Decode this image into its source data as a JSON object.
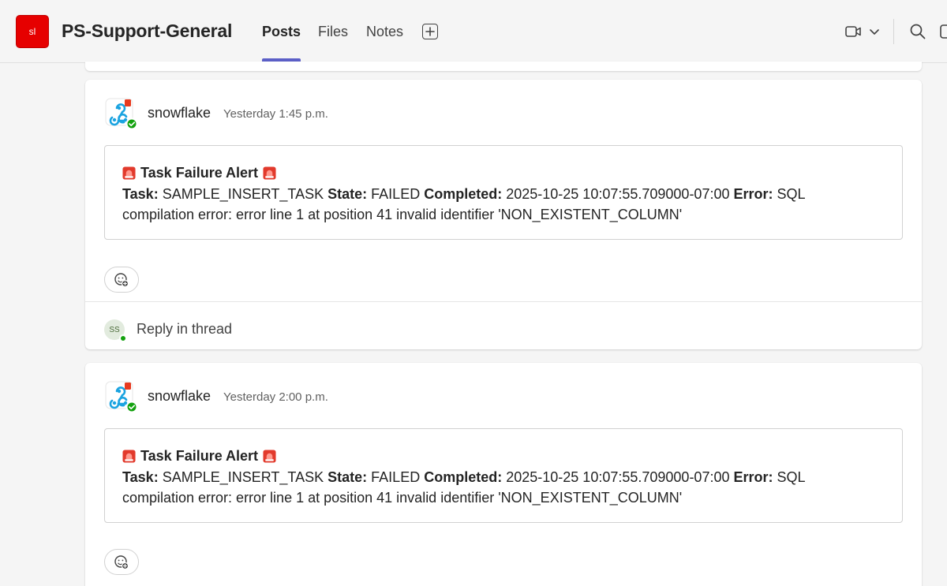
{
  "header": {
    "team_initials": "sl",
    "channel_name": "PS-Support-General",
    "tabs": [
      {
        "label": "Posts",
        "active": true
      },
      {
        "label": "Files",
        "active": false
      },
      {
        "label": "Notes",
        "active": false
      }
    ],
    "icons": [
      "plus-square-icon",
      "video-camera-icon",
      "chevron-down-icon",
      "search-icon",
      "more-icon"
    ],
    "accent_color": "#5b5fc7",
    "team_color": "#e60000"
  },
  "posts": [
    {
      "author": "snowflake",
      "timestamp": "Yesterday 1:45 p.m.",
      "alert_title": "Task Failure Alert",
      "alert": {
        "task_label": "Task:",
        "task_value": "SAMPLE_INSERT_TASK",
        "state_label": "State:",
        "state_value": "FAILED",
        "completed_label": "Completed:",
        "completed_value": "2025-10-25 10:07:55.709000-07:00",
        "error_label": "Error:",
        "error_value": "SQL compilation error: error line 1 at position 41 invalid identifier 'NON_EXISTENT_COLUMN'"
      },
      "reply_avatar": "SS",
      "reply_label": "Reply in thread"
    },
    {
      "author": "snowflake",
      "timestamp": "Yesterday 2:00 p.m.",
      "alert_title": "Task Failure Alert",
      "alert": {
        "task_label": "Task:",
        "task_value": "SAMPLE_INSERT_TASK",
        "state_label": "State:",
        "state_value": "FAILED",
        "completed_label": "Completed:",
        "completed_value": "2025-10-25 10:07:55.709000-07:00",
        "error_label": "Error:",
        "error_value": "SQL compilation error: error line 1 at position 41 invalid identifier 'NON_EXISTENT_COLUMN'"
      }
    }
  ]
}
